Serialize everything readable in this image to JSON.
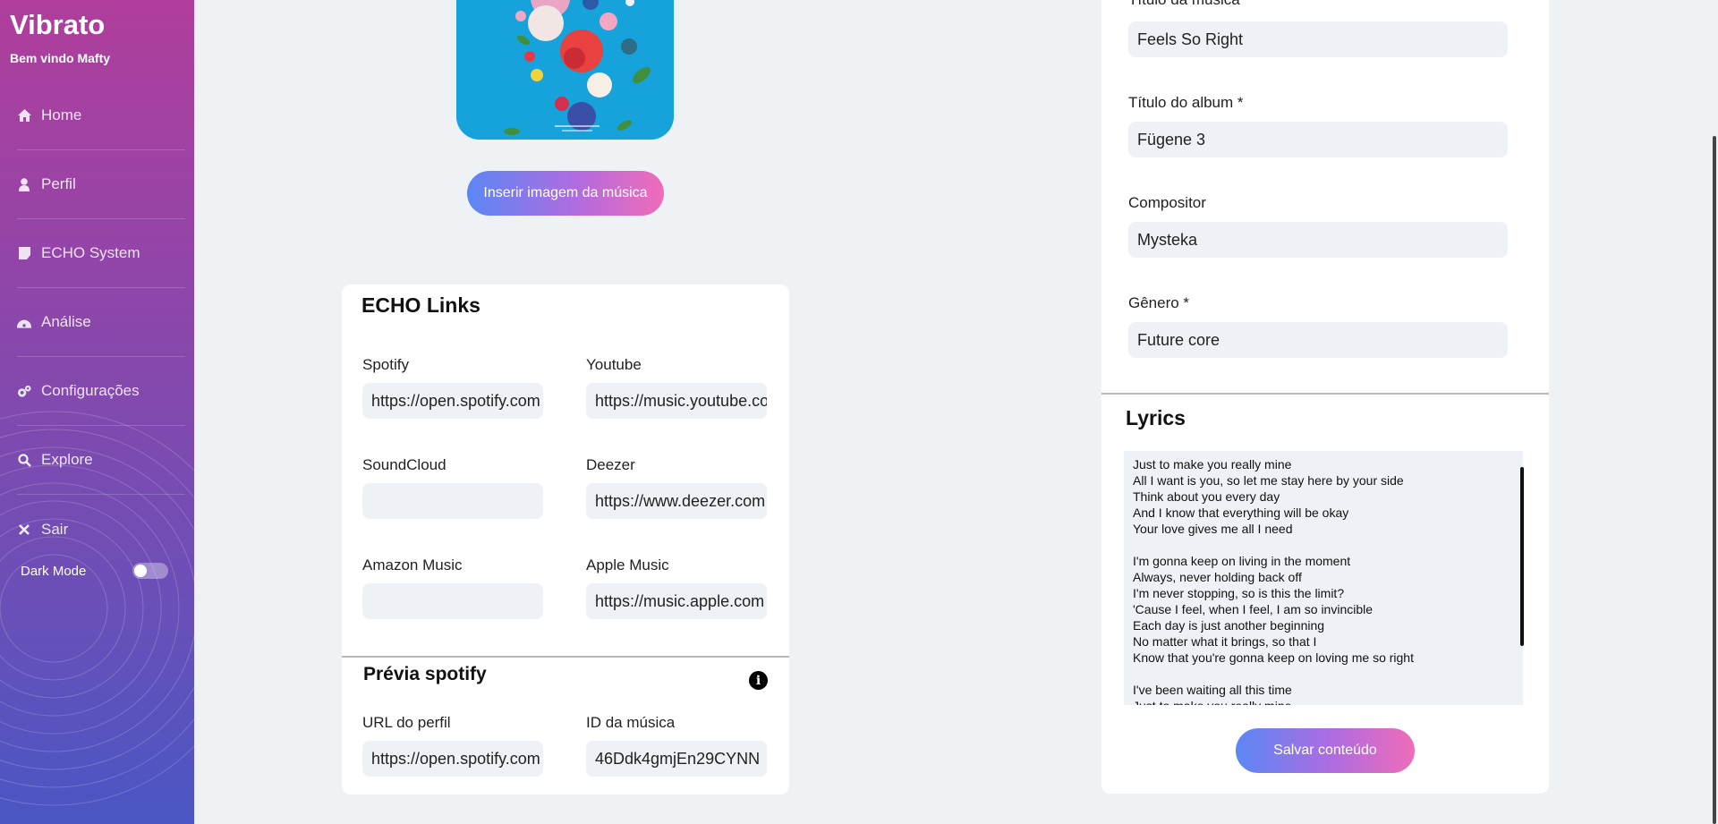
{
  "sidebar": {
    "brand": "Vibrato",
    "welcome": "Bem vindo Mafty",
    "items": [
      {
        "label": "Home",
        "icon": "home-icon"
      },
      {
        "label": "Perfil",
        "icon": "user-icon"
      },
      {
        "label": "ECHO System",
        "icon": "note-icon"
      },
      {
        "label": "Análise",
        "icon": "dashboard-icon"
      },
      {
        "label": "Configurações",
        "icon": "cogs-icon"
      },
      {
        "label": "Explore",
        "icon": "search-icon"
      },
      {
        "label": "Sair",
        "icon": "close-icon"
      }
    ],
    "dark_mode_label": "Dark Mode",
    "dark_mode_on": false
  },
  "cover": {
    "insert_button": "Inserir imagem da música"
  },
  "echo_links": {
    "title": "ECHO Links",
    "spotify_label": "Spotify",
    "spotify_value": "https://open.spotify.com",
    "youtube_label": "Youtube",
    "youtube_value": "https://music.youtube.com",
    "soundcloud_label": "SoundCloud",
    "soundcloud_value": "",
    "deezer_label": "Deezer",
    "deezer_value": "https://www.deezer.com",
    "amazon_label": "Amazon Music",
    "amazon_value": "",
    "apple_label": "Apple Music",
    "apple_value": "https://music.apple.com"
  },
  "spotify_preview": {
    "title": "Prévia spotify",
    "profile_label": "URL do perfil",
    "profile_value": "https://open.spotify.com",
    "track_label": "ID da música",
    "track_value": "46Ddk4gmjEn29CYNN"
  },
  "song": {
    "title_label": "Título da música *",
    "title_value": "Feels So Right",
    "album_label": "Título do album *",
    "album_value": "Fügene 3",
    "composer_label": "Compositor",
    "composer_value": "Mysteka",
    "genre_label": "Gênero *",
    "genre_value": "Future core"
  },
  "lyrics": {
    "title": "Lyrics",
    "text": "Just to make you really mine\nAll I want is you, so let me stay here by your side\nThink about you every day\nAnd I know that everything will be okay\nYour love gives me all I need\n\nI'm gonna keep on living in the moment\nAlways, never holding back off\nI'm never stopping, so is this the limit?\n'Cause I feel, when I feel, I am so invincible\nEach day is just another beginning\nNo matter what it brings, so that I\nKnow that you're gonna keep on loving me so right\n\nI've been waiting all this time\nJust to make you really mine",
    "save_button": "Salvar conteúdo"
  },
  "colors": {
    "accent_start": "#5b87f4",
    "accent_end": "#f06cb8",
    "sidebar_top": "#b03e9c",
    "sidebar_bottom": "#4a56c4",
    "background": "#eff2f5"
  }
}
